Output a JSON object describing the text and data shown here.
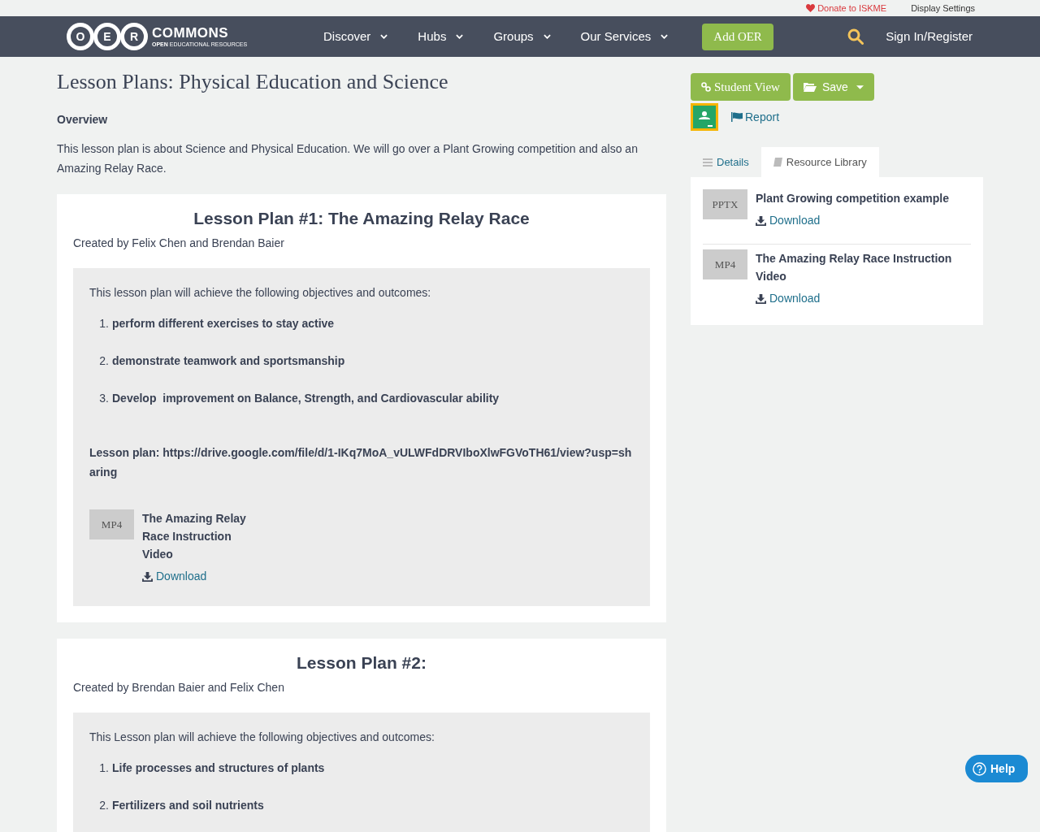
{
  "top_bar": {
    "donate": "Donate to ISKME",
    "display_settings": "Display Settings"
  },
  "nav": {
    "logo": {
      "letters": [
        "O",
        "E",
        "R"
      ],
      "name": "COMMONS",
      "tagline_bold": "OPEN",
      "tagline": "EDUCATIONAL RESOURCES"
    },
    "menu": [
      {
        "label": "Discover"
      },
      {
        "label": "Hubs"
      },
      {
        "label": "Groups"
      },
      {
        "label": "Our Services"
      }
    ],
    "add_button": "Add OER",
    "sign_in": "Sign In/Register"
  },
  "page": {
    "title": "Lesson Plans: Physical Education and Science",
    "overview_heading": "Overview",
    "overview_text": "This lesson plan is about Science and Physical Education. We will go over a Plant Growing competition and also an Amazing Relay Race."
  },
  "lessons": [
    {
      "title": "Lesson Plan #1: The Amazing Relay Race",
      "byline": "Created by Felix Chen and Brendan Baier",
      "intro": "This lesson plan will achieve the following objectives and outcomes:",
      "objectives": [
        {
          "number": "1.",
          "text": "perform different exercises to stay active"
        },
        {
          "number": "2.",
          "text": "demonstrate teamwork and sportsmanship"
        },
        {
          "number": "3.",
          "text": "Develop  improvement on Balance, Strength, and Cardiovascular ability"
        }
      ],
      "link_text": "Lesson plan: https://drive.google.com/file/d/1-IKq7MoA_vULWFdDRVIboXlwFGVoTH61/view?usp=sharing",
      "resources": [
        {
          "format": "MP4",
          "title": "The Amazing Relay Race Instruction Video",
          "download": "Download"
        }
      ]
    },
    {
      "title": "Lesson Plan #2:",
      "byline": "Created by Brendan Baier and Felix Chen",
      "intro": "This Lesson plan will achieve the following objectives and outcomes:",
      "objectives": [
        {
          "number": "1.",
          "text": "Life processes and structures of plants"
        },
        {
          "number": "2.",
          "text": "Fertilizers and soil nutrients"
        }
      ]
    }
  ],
  "sidebar": {
    "student_view": "Student View",
    "save": "Save",
    "report": "Report",
    "tabs": [
      {
        "label": "Details",
        "selected": false
      },
      {
        "label": "Resource Library",
        "selected": true
      }
    ],
    "resources": [
      {
        "format": "PPTX",
        "title": "Plant Growing competition example",
        "download": "Download"
      },
      {
        "format": "MP4",
        "title": "The Amazing Relay Race Instruction Video",
        "download": "Download"
      }
    ]
  },
  "help": "Help"
}
